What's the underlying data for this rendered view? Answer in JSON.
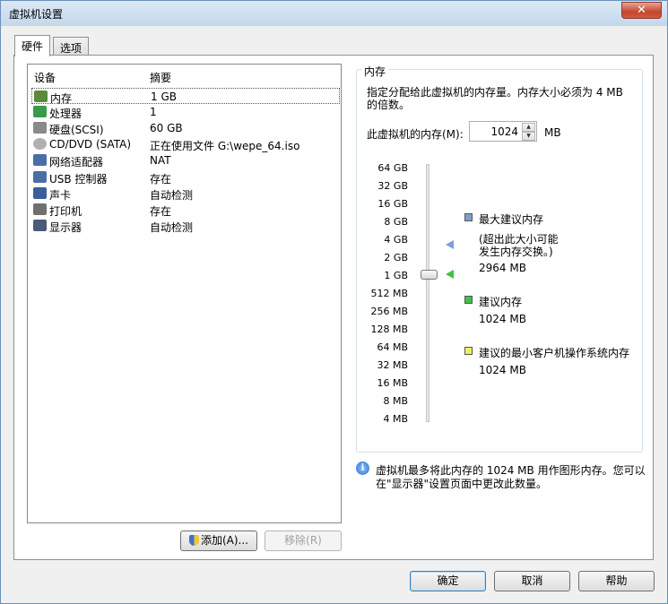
{
  "window": {
    "title": "虚拟机设置",
    "close_glyph": "✕"
  },
  "tabs": [
    {
      "label": "硬件",
      "active": true
    },
    {
      "label": "选项",
      "active": false
    }
  ],
  "device_list": {
    "columns": [
      "设备",
      "摘要"
    ],
    "rows": [
      {
        "name": "内存",
        "summary": "1 GB",
        "icon": "memory-icon",
        "selected": true
      },
      {
        "name": "处理器",
        "summary": "1",
        "icon": "processor-icon"
      },
      {
        "name": "硬盘(SCSI)",
        "summary": "60 GB",
        "icon": "hard-disk-icon"
      },
      {
        "name": "CD/DVD (SATA)",
        "summary": "正在使用文件 G:\\wepe_64.iso",
        "icon": "cd-dvd-icon"
      },
      {
        "name": "网络适配器",
        "summary": "NAT",
        "icon": "network-adapter-icon"
      },
      {
        "name": "USB 控制器",
        "summary": "存在",
        "icon": "usb-icon"
      },
      {
        "name": "声卡",
        "summary": "自动检测",
        "icon": "sound-card-icon"
      },
      {
        "name": "打印机",
        "summary": "存在",
        "icon": "printer-icon"
      },
      {
        "name": "显示器",
        "summary": "自动检测",
        "icon": "display-icon"
      }
    ],
    "add_button": "添加(A)...",
    "remove_button": "移除(R)"
  },
  "memory": {
    "group_title": "内存",
    "description_line1": "指定分配给此虚拟机的内存量。内存大小必须为 4 MB",
    "description_line2": "的倍数。",
    "field_label": "此虚拟机的内存(M):",
    "value": "1024",
    "unit": "MB",
    "scale_ticks": [
      "64 GB",
      "32 GB",
      "16 GB",
      "8 GB",
      "4 GB",
      "2 GB",
      "1 GB",
      "512 MB",
      "256 MB",
      "128 MB",
      "64 MB",
      "32 MB",
      "16 MB",
      "8 MB",
      "4 MB"
    ],
    "slider_value_mb": 1024,
    "legend": {
      "max": {
        "label": "最大建议内存",
        "note_line1": "(超出此大小可能",
        "note_line2": "发生内存交换。)",
        "value": "2964 MB",
        "color": "#7d9fd4"
      },
      "recommended": {
        "label": "建议内存",
        "value": "1024 MB",
        "color": "#3ec43e"
      },
      "min_os": {
        "label": "建议的最小客户机操作系统内存",
        "value": "1024 MB",
        "color": "#f0f05a"
      }
    },
    "info_glyph": "i",
    "info_line1": "虚拟机最多将此内存的 1024 MB 用作图形内存。您可以",
    "info_line2": "在\"显示器\"设置页面中更改此数量。"
  },
  "footer": {
    "ok": "确定",
    "cancel": "取消",
    "help": "帮助"
  }
}
